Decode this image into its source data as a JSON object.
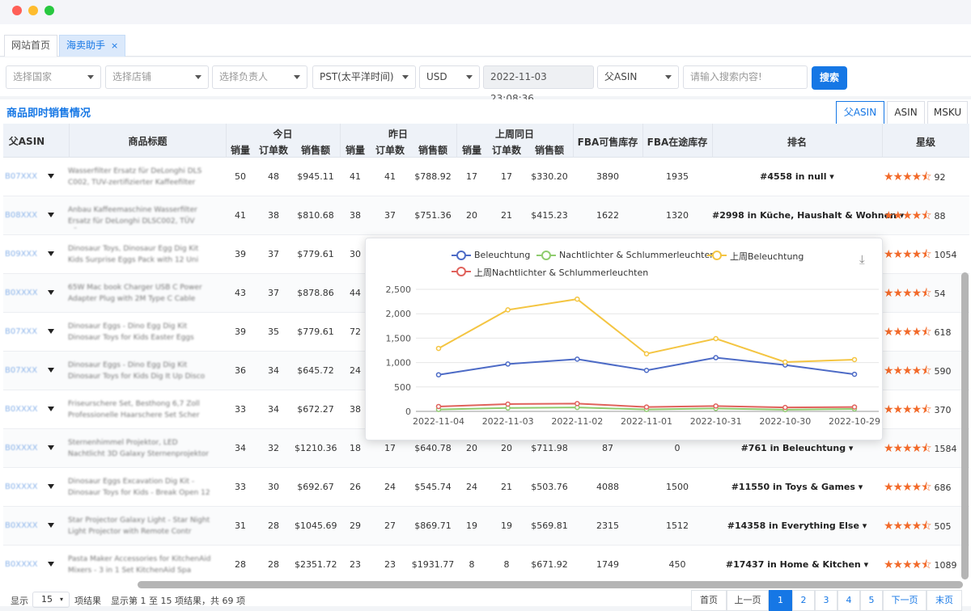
{
  "window": {
    "dots": [
      "#ff5f57",
      "#febc2e",
      "#28c840"
    ]
  },
  "tabs": [
    {
      "label": "网站首页",
      "active": false
    },
    {
      "label": "海卖助手",
      "active": true,
      "close": "×"
    }
  ],
  "filters": {
    "country": "选择国家",
    "shop": "选择店铺",
    "owner": "选择负责人",
    "timezone": "PST(太平洋时间)",
    "currency": "USD",
    "datetime": "2022-11-03 23:08:36",
    "asin_type": "父ASIN",
    "search_placeholder": "请输入搜索内容!",
    "search_button": "搜索"
  },
  "section": {
    "title": "商品即时销售情况",
    "view_tabs": [
      "父ASIN",
      "ASIN",
      "MSKU"
    ]
  },
  "table": {
    "headers": {
      "asin": "父ASIN",
      "title": "商品标题",
      "today": "今日",
      "yesterday": "昨日",
      "lastweek": "上周同日",
      "sub_sales": "销量",
      "sub_orders": "订单数",
      "sub_amount": "销售额",
      "fba_stock": "FBA可售库存",
      "fba_transit": "FBA在途库存",
      "rank": "排名",
      "rating": "星级"
    },
    "rows": [
      {
        "asin": "B07XXXX5",
        "title": "Wasserfilter Ersatz für DeLonghi DLS C002, TUV-zertifizierter Kaffeefilter",
        "today": [
          "50",
          "48",
          "$945.11"
        ],
        "yesterday": [
          "41",
          "41",
          "$788.92"
        ],
        "lastweek": [
          "17",
          "17",
          "$330.20"
        ],
        "fba": "3890",
        "transit": "1935",
        "rank": "#4558 in null ▾",
        "stars": 4.5,
        "count": "92"
      },
      {
        "asin": "B08XXXX1",
        "title": "Anbau Kaffeemaschine Wasserfilter Ersatz für DeLonghi DLSC002, TÜV SÜD",
        "today": [
          "41",
          "38",
          "$810.68"
        ],
        "yesterday": [
          "38",
          "37",
          "$751.36"
        ],
        "lastweek": [
          "20",
          "21",
          "$415.23"
        ],
        "fba": "1622",
        "transit": "1320",
        "rank": "#2998 in Küche, Haushalt & Wohnen ▾",
        "stars": 4.5,
        "count": "88"
      },
      {
        "asin": "B09XXXX2",
        "title": "Dinosaur Toys, Dinosaur Egg Dig Kit Kids Surprise Eggs Pack with 12 Uni",
        "today": [
          "39",
          "37",
          "$779.61"
        ],
        "yesterday": [
          "30",
          "",
          ""
        ],
        "lastweek": [
          "",
          "",
          ""
        ],
        "fba": "",
        "transit": "",
        "rank": "",
        "stars": 4.5,
        "count": "1054"
      },
      {
        "asin": "B0XXXXK",
        "title": "65W Mac book Charger USB C Power Adapter Plug with 2M Type C Cable",
        "today": [
          "43",
          "37",
          "$878.86"
        ],
        "yesterday": [
          "44",
          "",
          ""
        ],
        "lastweek": [
          "",
          "",
          ""
        ],
        "fba": "",
        "transit": "",
        "rank": "",
        "stars": 4.5,
        "count": "54"
      },
      {
        "asin": "B07XXXXF",
        "title": "Dinosaur Eggs - Dino Egg Dig Kit Dinosaur Toys for Kids Easter Eggs Excav",
        "today": [
          "39",
          "35",
          "$779.61"
        ],
        "yesterday": [
          "72",
          "",
          ""
        ],
        "lastweek": [
          "",
          "",
          ""
        ],
        "fba": "",
        "transit": "",
        "rank": "",
        "stars": 4.5,
        "count": "618"
      },
      {
        "asin": "B07XXXXF",
        "title": "Dinosaur Eggs - Dino Egg Dig Kit Dinosaur Toys for Kids Dig It Up Disco",
        "today": [
          "36",
          "34",
          "$645.72"
        ],
        "yesterday": [
          "24",
          "",
          ""
        ],
        "lastweek": [
          "",
          "",
          ""
        ],
        "fba": "",
        "transit": "",
        "rank": "",
        "stars": 4.5,
        "count": "590"
      },
      {
        "asin": "B0XXXXX2",
        "title": "Friseurschere Set, Besthong 6,7 Zoll Professionelle Haarschere Set Scher",
        "today": [
          "33",
          "34",
          "$672.27"
        ],
        "yesterday": [
          "38",
          "",
          ""
        ],
        "lastweek": [
          "",
          "",
          ""
        ],
        "fba": "",
        "transit": "",
        "rank": "",
        "stars": 4.5,
        "count": "370"
      },
      {
        "asin": "B0XXXXT",
        "title": "Sternenhimmel Projektor, LED Nachtlicht 3D Galaxy Sternenprojektor Lampe",
        "today": [
          "34",
          "32",
          "$1210.36"
        ],
        "yesterday": [
          "18",
          "17",
          "$640.78"
        ],
        "lastweek": [
          "20",
          "20",
          "$711.98"
        ],
        "fba": "87",
        "transit": "0",
        "rank": "#761 in Beleuchtung ▾",
        "stars": 4.5,
        "count": "1584"
      },
      {
        "asin": "B0XXXXF3",
        "title": "Dinosaur Eggs Excavation Dig Kit - Dinosaur Toys for Kids - Break Open 12",
        "today": [
          "33",
          "30",
          "$692.67"
        ],
        "yesterday": [
          "26",
          "24",
          "$545.74"
        ],
        "lastweek": [
          "24",
          "21",
          "$503.76"
        ],
        "fba": "4088",
        "transit": "1500",
        "rank": "#11550 in Toys & Games ▾",
        "stars": 4.5,
        "count": "686"
      },
      {
        "asin": "B0XXXX4F",
        "title": "Star Projector Galaxy Light - Star Night Light Projector with Remote Contr",
        "today": [
          "31",
          "28",
          "$1045.69"
        ],
        "yesterday": [
          "29",
          "27",
          "$869.71"
        ],
        "lastweek": [
          "19",
          "19",
          "$569.81"
        ],
        "fba": "2315",
        "transit": "1512",
        "rank": "#14358 in Everything Else ▾",
        "stars": 4.5,
        "count": "505"
      },
      {
        "asin": "B0XXXXN",
        "title": "Pasta Maker Accessories for KitchenAid Mixers - 3 in 1 Set KitchenAid Spa",
        "today": [
          "28",
          "28",
          "$2351.72"
        ],
        "yesterday": [
          "23",
          "23",
          "$1931.77"
        ],
        "lastweek": [
          "8",
          "8",
          "$671.92"
        ],
        "fba": "1749",
        "transit": "450",
        "rank": "#17437 in Home & Kitchen ▾",
        "stars": 4.5,
        "count": "1089"
      }
    ]
  },
  "pager": {
    "show": "显示",
    "page_size": "15",
    "unit": "项结果",
    "summary": "显示第 1 至 15 项结果，共 69 项",
    "first": "首页",
    "prev": "上一页",
    "pages": [
      "1",
      "2",
      "3",
      "4",
      "5"
    ],
    "next": "下一页",
    "last": "末页"
  },
  "chart_data": {
    "type": "line",
    "x": [
      "2022-11-04",
      "2022-11-03",
      "2022-11-02",
      "2022-11-01",
      "2022-10-31",
      "2022-10-30",
      "2022-10-29"
    ],
    "ylim": [
      0,
      2500
    ],
    "yticks": [
      "0",
      "500",
      "1,000",
      "1,500",
      "2,000",
      "2,500"
    ],
    "grid": true,
    "legend_position": "top",
    "series": [
      {
        "name": "Beleuchtung",
        "color": "#4d6bc6",
        "values": [
          750,
          970,
          1070,
          840,
          1100,
          950,
          760
        ]
      },
      {
        "name": "Nachtlichter & Schlummerleuchten",
        "color": "#8fcc6e",
        "values": [
          40,
          70,
          80,
          40,
          60,
          35,
          50
        ]
      },
      {
        "name": "上周Beleuchtung",
        "color": "#f4c542",
        "values": [
          1290,
          2080,
          2300,
          1180,
          1490,
          1010,
          1060
        ]
      },
      {
        "name": "上周Nachtlichter & Schlummerleuchten",
        "color": "#e0625c",
        "values": [
          100,
          150,
          160,
          90,
          110,
          80,
          90
        ]
      }
    ]
  }
}
